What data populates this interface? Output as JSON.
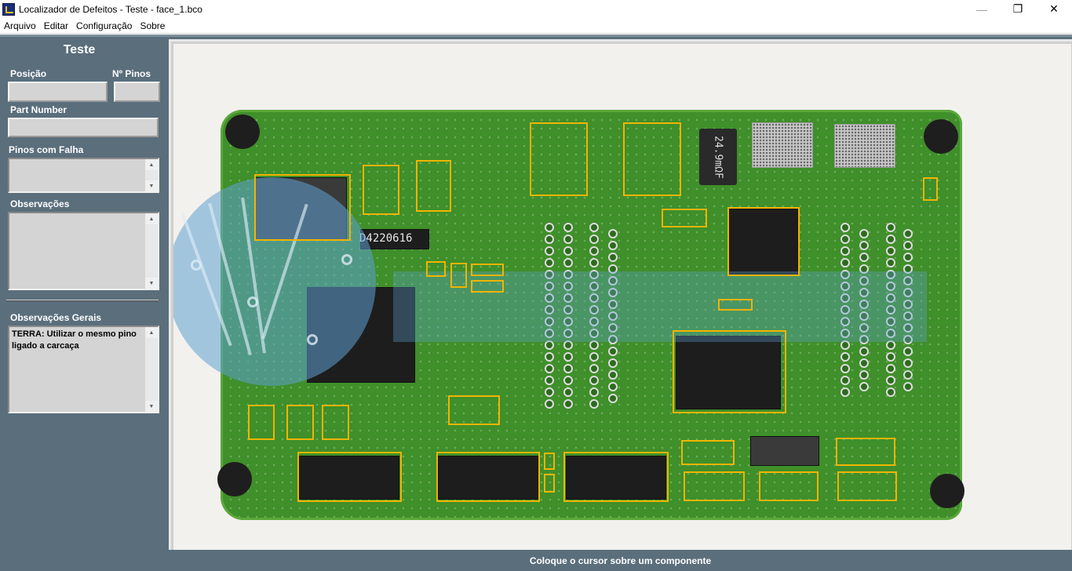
{
  "window": {
    "title": "Localizador de Defeitos - Teste - face_1.bco",
    "minimize_glyph": "—",
    "maximize_glyph": "❐",
    "close_glyph": "✕"
  },
  "menu": {
    "items": [
      "Arquivo",
      "Editar",
      "Configuração",
      "Sobre"
    ]
  },
  "panel": {
    "title": "Teste",
    "posicao_label": "Posição",
    "posicao_value": "",
    "npinos_label": "Nº Pinos",
    "npinos_value": "",
    "part_number_label": "Part Number",
    "part_number_value": "",
    "pinos_falha_label": "Pinos com Falha",
    "pinos_falha_value": "",
    "observacoes_label": "Observações",
    "observacoes_value": "",
    "observacoes_gerais_label": "Observações Gerais",
    "observacoes_gerais_value": "TERRA: Utilizar o mesmo pino ligado a carcaça"
  },
  "board": {
    "labels": [
      "D4220616",
      "24.9mΩF"
    ],
    "highlight_color": "#f2b400"
  },
  "status": {
    "text": "Coloque o cursor sobre um componente"
  },
  "icons": {
    "scroll_up": "▲",
    "scroll_down": "▼"
  },
  "colors": {
    "panel_bg": "#5a6e7c",
    "pcb_green": "#3f8f2a",
    "field_bg": "#d4d4d4"
  }
}
